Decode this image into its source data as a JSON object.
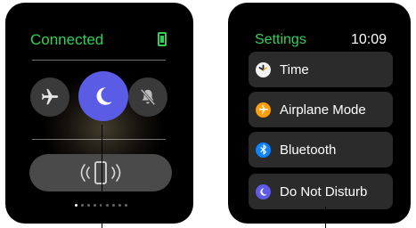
{
  "left_watch": {
    "status": "Connected",
    "toggles": [
      {
        "name": "airplane",
        "icon": "airplane-icon",
        "active": false
      },
      {
        "name": "do-not-disturb",
        "icon": "moon-icon",
        "active": true
      },
      {
        "name": "silent",
        "icon": "bell-slash-icon",
        "active": false
      }
    ],
    "ping_icon": "phone-ping-icon",
    "pages": {
      "count": 9,
      "current": 1
    }
  },
  "right_watch": {
    "title": "Settings",
    "clock": "10:09",
    "rows": [
      {
        "label": "Time",
        "icon": "clock-icon",
        "icon_color": "#f5f5f5"
      },
      {
        "label": "Airplane Mode",
        "icon": "airplane-icon",
        "icon_color": "#ff9f0a"
      },
      {
        "label": "Bluetooth",
        "icon": "bluetooth-icon",
        "icon_color": "#0a84ff"
      },
      {
        "label": "Do Not Disturb",
        "icon": "moon-icon",
        "icon_color": "#5e5ce6"
      }
    ]
  },
  "colors": {
    "status_green": "#31d158",
    "dnd_purple": "#5b5ce6",
    "row_background": "#2b2b2b",
    "toggle_gray": "#3a3a3a"
  }
}
